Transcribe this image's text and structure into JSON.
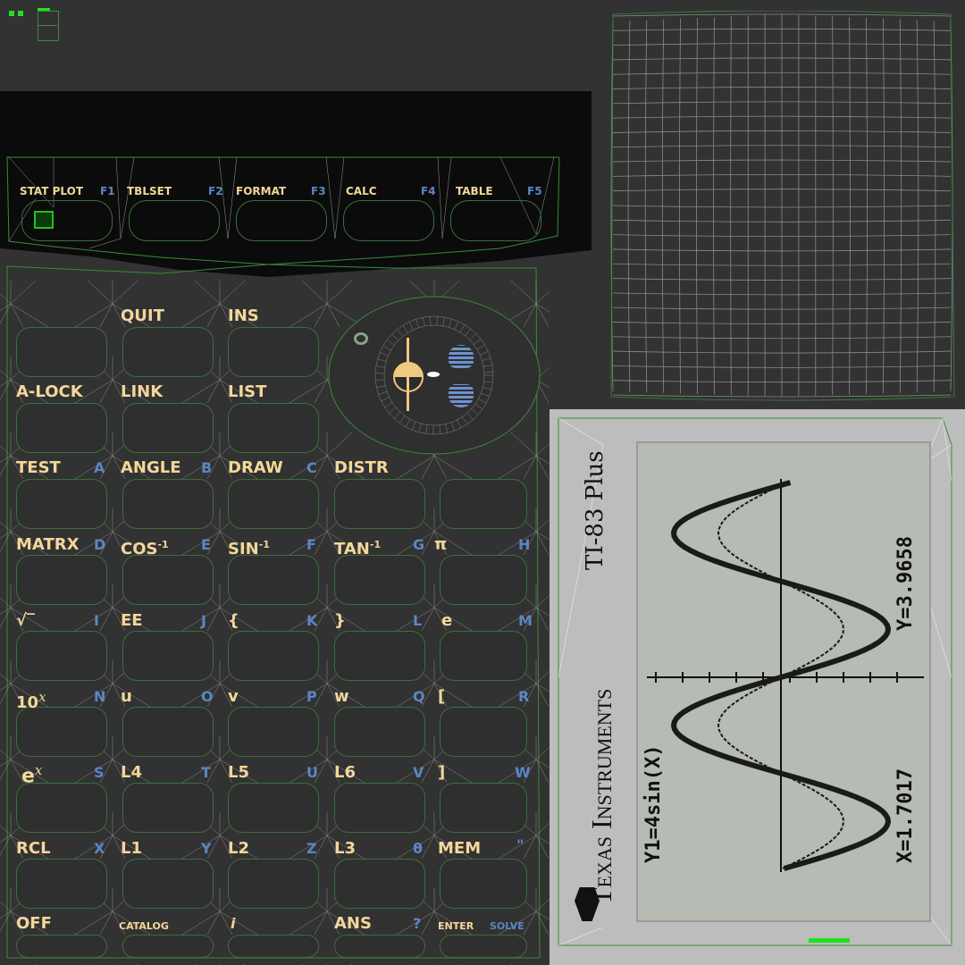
{
  "corner_icon": "grid-icon",
  "top_bar": {
    "stat_plot": "STAT PLOT",
    "f1": "F1",
    "tblset": "TBLSET",
    "f2": "F2",
    "format": "FORMAT",
    "f3": "F3",
    "calc": "CALC",
    "f4": "F4",
    "table": "TABLE",
    "f5": "F5"
  },
  "keys": {
    "row1": {
      "quit": "QUIT",
      "ins": "INS"
    },
    "row2": {
      "alock": "A-LOCK",
      "link": "LINK",
      "list": "LIST"
    },
    "row3": {
      "test": "TEST",
      "a": "A",
      "angle": "ANGLE",
      "b": "B",
      "draw": "DRAW",
      "c": "C",
      "distr": "DISTR"
    },
    "row4": {
      "matrx": "MATRX",
      "d": "D",
      "cos": "COS",
      "cos_sup": "-1",
      "e": "E",
      "sin": "SIN",
      "sin_sup": "-1",
      "f": "F",
      "tan": "TAN",
      "tan_sup": "-1",
      "g": "G",
      "pi": "π",
      "h": "H"
    },
    "row5": {
      "sqrt": "√‾",
      "i": "I",
      "ee": "EE",
      "j": "J",
      "lbrace": "{",
      "k": "K",
      "rbrace": "}",
      "l": "L",
      "e_const": "e",
      "m": "M"
    },
    "row6": {
      "ten": "10",
      "ten_sup": "x",
      "n": "N",
      "u": "u",
      "o": "O",
      "v": "v",
      "p": "P",
      "w": "w",
      "q": "Q",
      "lbracket": "[",
      "r": "R"
    },
    "row7": {
      "ex": "e",
      "ex_sup": "x",
      "s": "S",
      "l4": "L4",
      "t": "T",
      "l5": "L5",
      "uu": "U",
      "l6": "L6",
      "vv": "V",
      "rbracket": "]",
      "ww": "W"
    },
    "row8": {
      "rcl": "RCL",
      "x": "X",
      "l1": "L1",
      "y": "Y",
      "l2": "L2",
      "z": "Z",
      "l3": "L3",
      "theta": "θ",
      "mem": "MEM",
      "quote": "\""
    },
    "row9": {
      "off": "OFF",
      "catalog": "CATALOG",
      "i_const": "i",
      "ans": "ANS",
      "question": "?",
      "enter": "ENTER",
      "solve": "SOLVE"
    }
  },
  "faceplate": {
    "model": "TI-83 Plus",
    "brand": "Texas Instruments",
    "logo_icon": "ti-logo-icon"
  },
  "screen": {
    "func": "Y1=4sin(X)",
    "x_readout": "X=1.7017",
    "y_readout": "Y=3.9658"
  },
  "colors": {
    "background": "#323232",
    "wire": "#3c8a3c",
    "label": "#f3d79a",
    "alpha": "#5b86c4",
    "lcd": "#b8bdb5",
    "faceplate": "#bdbdbd"
  }
}
